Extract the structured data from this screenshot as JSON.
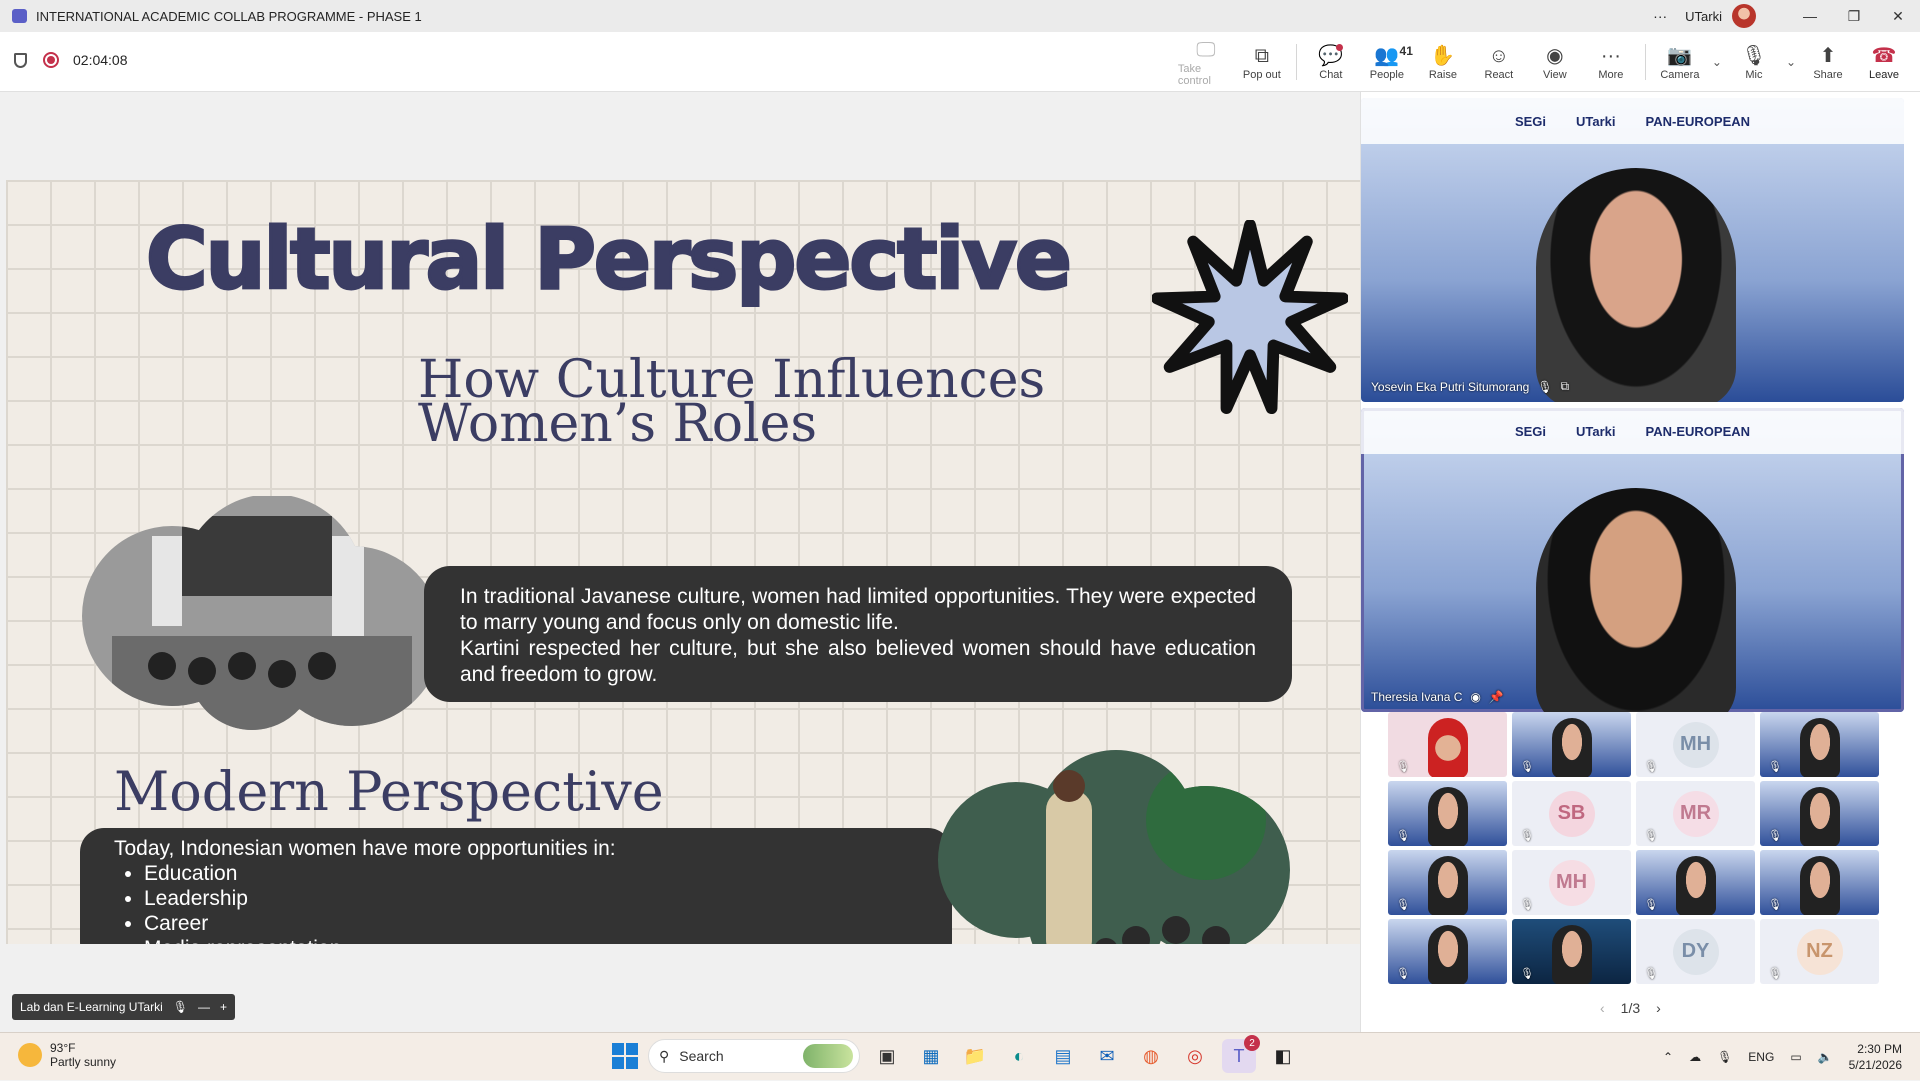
{
  "window": {
    "title": "INTERNATIONAL ACADEMIC COLLAB PROGRAMME - PHASE 1",
    "user": "UTarki",
    "more": "···",
    "minimize": "—",
    "restore": "❐",
    "close": "✕"
  },
  "meeting": {
    "timer": "02:04:08",
    "people_count": "41",
    "tools": {
      "take_control": "Take control",
      "pop_out": "Pop out",
      "chat": "Chat",
      "people": "People",
      "raise": "Raise",
      "react": "React",
      "view": "View",
      "more": "More",
      "camera": "Camera",
      "mic": "Mic",
      "share": "Share",
      "leave": "Leave"
    }
  },
  "slide": {
    "title": "Cultural Perspective",
    "subtitle1": "How Culture Influences Women’s Roles",
    "paragraph1": "In traditional Javanese culture, women had limited opportunities. They were expected to marry young and focus only on domestic life.",
    "paragraph2": "Kartini respected her culture, but she also believed women should have education and freedom to grow.",
    "subtitle2": "Modern Perspective",
    "intro2": "Today, Indonesian women have more opportunities in:",
    "bullets": [
      "Education",
      "Leadership",
      "Career",
      "Media representation"
    ]
  },
  "video_tiles": {
    "banner": {
      "segi": "SEGi",
      "utarki": "UTarki",
      "panEuropean": "PAN-EUROPEAN"
    },
    "speaker1": "Yosevin Eka Putri Situmorang",
    "speaker2": "Theresia Ivana C"
  },
  "participant_grid": {
    "initials": [
      "MH",
      "SB",
      "MR",
      "MH",
      "DY",
      "NZ"
    ],
    "page": "1/3"
  },
  "pip_label": "Lab dan E-Learning UTarki",
  "taskbar": {
    "temperature": "93°F",
    "weather": "Partly sunny",
    "search": "Search",
    "teams_badge": "2",
    "language": "ENG",
    "time": "2:30 PM",
    "date": "5/21/2026"
  },
  "colors": {
    "accent": "#6264a7",
    "leave": "#c4314b",
    "slide_title": "#3b3d63"
  }
}
